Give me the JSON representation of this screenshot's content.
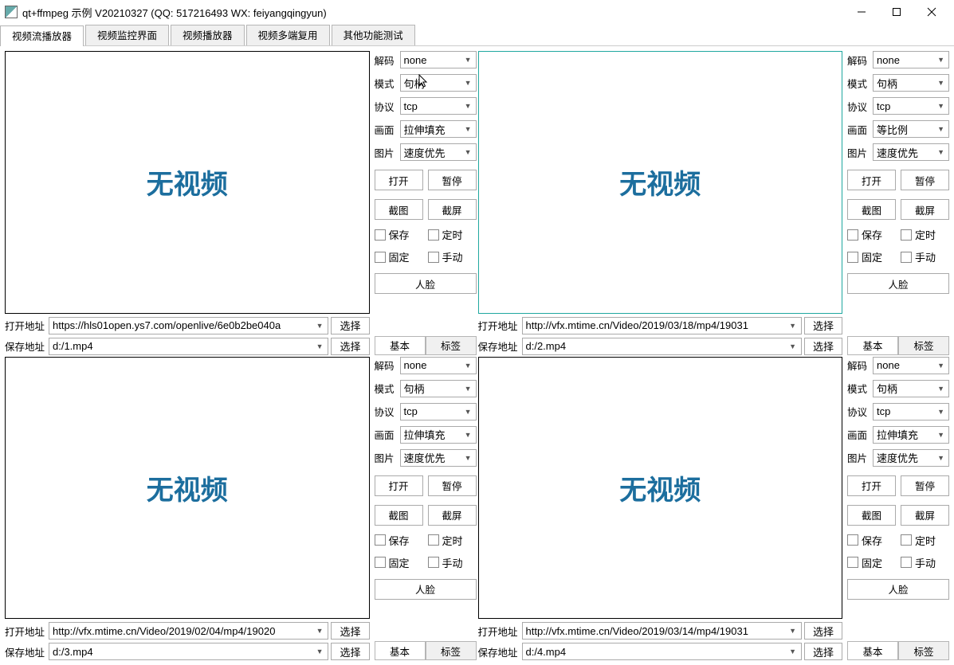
{
  "window": {
    "title": "qt+ffmpeg 示例 V20210327 (QQ: 517216493 WX: feiyangqingyun)"
  },
  "tabs": [
    "视频流播放器",
    "视频监控界面",
    "视频播放器",
    "视频多端复用",
    "其他功能测试"
  ],
  "labels": {
    "novideo": "无视频",
    "decode": "解码",
    "mode": "模式",
    "proto": "协议",
    "aspect": "画面",
    "image": "图片",
    "open": "打开",
    "pause": "暂停",
    "shot": "截图",
    "screen": "截屏",
    "save": "保存",
    "timer": "定时",
    "fixed": "固定",
    "manual": "手动",
    "face": "人脸",
    "basic": "基本",
    "tag": "标签",
    "open_addr": "打开地址",
    "save_addr": "保存地址",
    "choose": "选择"
  },
  "cells": [
    {
      "decode": "none",
      "mode": "句柄",
      "proto": "tcp",
      "aspect": "拉伸填充",
      "image": "速度优先",
      "open_url": "https://hls01open.ys7.com/openlive/6e0b2be040a",
      "save_url": "d:/1.mp4",
      "sel": false
    },
    {
      "decode": "none",
      "mode": "句柄",
      "proto": "tcp",
      "aspect": "等比例",
      "image": "速度优先",
      "open_url": "http://vfx.mtime.cn/Video/2019/03/18/mp4/19031",
      "save_url": "d:/2.mp4",
      "sel": true
    },
    {
      "decode": "none",
      "mode": "句柄",
      "proto": "tcp",
      "aspect": "拉伸填充",
      "image": "速度优先",
      "open_url": "http://vfx.mtime.cn/Video/2019/02/04/mp4/19020",
      "save_url": "d:/3.mp4",
      "sel": false
    },
    {
      "decode": "none",
      "mode": "句柄",
      "proto": "tcp",
      "aspect": "拉伸填充",
      "image": "速度优先",
      "open_url": "http://vfx.mtime.cn/Video/2019/03/14/mp4/19031",
      "save_url": "d:/4.mp4",
      "sel": false
    }
  ]
}
